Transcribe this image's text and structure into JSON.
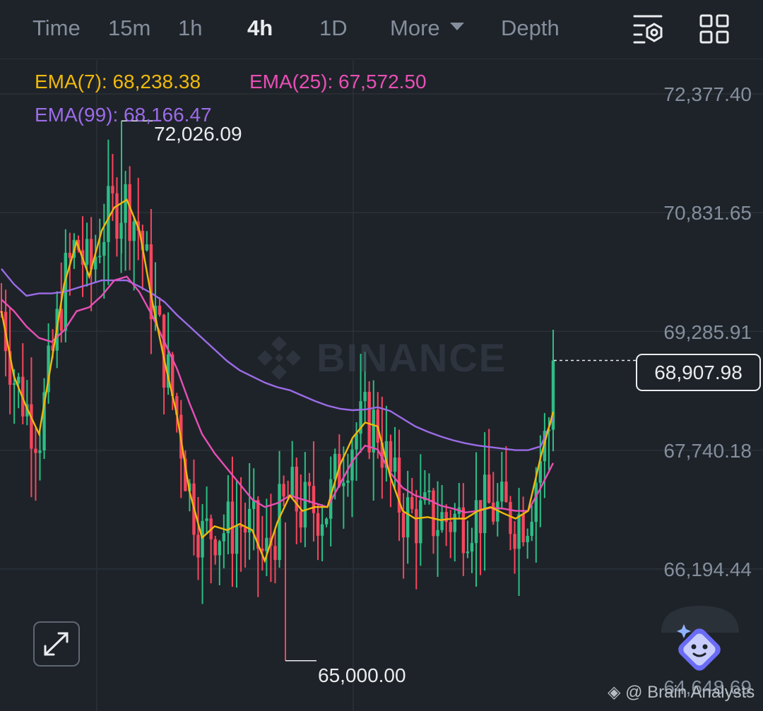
{
  "toolbar": {
    "tabs": [
      {
        "label": "Time",
        "active": false
      },
      {
        "label": "15m",
        "active": false
      },
      {
        "label": "1h",
        "active": false
      },
      {
        "label": "4h",
        "active": true
      },
      {
        "label": "1D",
        "active": false
      },
      {
        "label": "More",
        "active": false
      },
      {
        "label": "Depth",
        "active": false
      }
    ],
    "icons": [
      "settings-sliders-icon",
      "grid-layout-icon"
    ]
  },
  "indicators": {
    "ema7": "EMA(7): 68,238.38",
    "ema25": "EMA(25): 67,572.50",
    "ema99": "EMA(99): 68,166.47"
  },
  "colors": {
    "background": "#1e2329",
    "up": "#2ebd85",
    "down": "#f6465d",
    "ema7": "#f0b90b",
    "ema25": "#e84fb5",
    "ema99": "#9c6ce8",
    "text": "#848e9c"
  },
  "price_axis": {
    "labels": [
      "72,377.40",
      "70,831.65",
      "69,285.91",
      "67,740.18",
      "66,194.44",
      "64,648.69"
    ]
  },
  "last_price": "68,907.98",
  "annotations": {
    "high": "72,026.09",
    "low": "65,000.00"
  },
  "watermark": "BINANCE",
  "credit": "@ Brain Analysts",
  "chart_data": {
    "type": "candlestick",
    "interval": "4h",
    "ylim": [
      64648.69,
      73000
    ],
    "grid": true,
    "last_price": 68907.98,
    "high_marker": 72026.09,
    "low_marker": 65000.0,
    "ema7_points": [
      [
        0,
        69550
      ],
      [
        1,
        68700
      ],
      [
        2,
        68300
      ],
      [
        3,
        67950
      ],
      [
        4,
        68900
      ],
      [
        5,
        69900
      ],
      [
        6,
        70450
      ],
      [
        7,
        70000
      ],
      [
        8,
        70600
      ],
      [
        9,
        70900
      ],
      [
        10,
        71000
      ],
      [
        11,
        70600
      ],
      [
        12,
        69700
      ],
      [
        13,
        68900
      ],
      [
        14,
        68200
      ],
      [
        15,
        67200
      ],
      [
        16,
        66600
      ],
      [
        17,
        66750
      ],
      [
        18,
        66700
      ],
      [
        19,
        66780
      ],
      [
        20,
        66700
      ],
      [
        21,
        66300
      ],
      [
        22,
        66800
      ],
      [
        23,
        67150
      ],
      [
        24,
        66950
      ],
      [
        25,
        67000
      ],
      [
        26,
        67000
      ],
      [
        27,
        67550
      ],
      [
        28,
        67900
      ],
      [
        29,
        68100
      ],
      [
        30,
        68050
      ],
      [
        31,
        67400
      ],
      [
        32,
        66950
      ],
      [
        33,
        66850
      ],
      [
        34,
        66870
      ],
      [
        35,
        66830
      ],
      [
        36,
        66850
      ],
      [
        37,
        66850
      ],
      [
        38,
        66950
      ],
      [
        39,
        67000
      ],
      [
        40,
        66920
      ],
      [
        41,
        66850
      ],
      [
        42,
        66950
      ],
      [
        43,
        67650
      ],
      [
        44,
        68238.38
      ]
    ],
    "ema25_points": [
      [
        0,
        69700
      ],
      [
        1,
        69550
      ],
      [
        2,
        69350
      ],
      [
        3,
        69200
      ],
      [
        4,
        69150
      ],
      [
        5,
        69300
      ],
      [
        6,
        69550
      ],
      [
        7,
        69600
      ],
      [
        8,
        69750
      ],
      [
        9,
        69950
      ],
      [
        10,
        70000
      ],
      [
        11,
        69800
      ],
      [
        12,
        69500
      ],
      [
        13,
        69150
      ],
      [
        14,
        68800
      ],
      [
        15,
        68350
      ],
      [
        16,
        67950
      ],
      [
        17,
        67700
      ],
      [
        18,
        67500
      ],
      [
        19,
        67300
      ],
      [
        20,
        67100
      ],
      [
        21,
        67000
      ],
      [
        22,
        67050
      ],
      [
        23,
        67150
      ],
      [
        24,
        67100
      ],
      [
        25,
        67050
      ],
      [
        26,
        67000
      ],
      [
        27,
        67300
      ],
      [
        28,
        67600
      ],
      [
        29,
        67800
      ],
      [
        30,
        67750
      ],
      [
        31,
        67450
      ],
      [
        32,
        67250
      ],
      [
        33,
        67150
      ],
      [
        34,
        67100
      ],
      [
        35,
        67020
      ],
      [
        36,
        66980
      ],
      [
        37,
        66930
      ],
      [
        38,
        66950
      ],
      [
        39,
        66990
      ],
      [
        40,
        66980
      ],
      [
        41,
        66950
      ],
      [
        42,
        66950
      ],
      [
        43,
        67250
      ],
      [
        44,
        67572.5
      ]
    ],
    "ema99_points": [
      [
        0,
        70100
      ],
      [
        1,
        69900
      ],
      [
        2,
        69750
      ],
      [
        3,
        69780
      ],
      [
        4,
        69780
      ],
      [
        5,
        69800
      ],
      [
        6,
        69850
      ],
      [
        7,
        69900
      ],
      [
        8,
        69950
      ],
      [
        9,
        69950
      ],
      [
        10,
        69950
      ],
      [
        11,
        69870
      ],
      [
        12,
        69780
      ],
      [
        13,
        69670
      ],
      [
        14,
        69500
      ],
      [
        15,
        69350
      ],
      [
        16,
        69200
      ],
      [
        17,
        69050
      ],
      [
        18,
        68900
      ],
      [
        19,
        68780
      ],
      [
        20,
        68700
      ],
      [
        21,
        68620
      ],
      [
        22,
        68560
      ],
      [
        23,
        68520
      ],
      [
        24,
        68450
      ],
      [
        25,
        68380
      ],
      [
        26,
        68320
      ],
      [
        27,
        68280
      ],
      [
        28,
        68260
      ],
      [
        29,
        68270
      ],
      [
        30,
        68300
      ],
      [
        31,
        68250
      ],
      [
        32,
        68150
      ],
      [
        33,
        68050
      ],
      [
        34,
        67980
      ],
      [
        35,
        67920
      ],
      [
        36,
        67870
      ],
      [
        37,
        67830
      ],
      [
        38,
        67800
      ],
      [
        39,
        67780
      ],
      [
        40,
        67760
      ],
      [
        41,
        67740
      ],
      [
        42,
        67740
      ],
      [
        43,
        67790
      ],
      [
        44,
        68166.47
      ]
    ]
  }
}
